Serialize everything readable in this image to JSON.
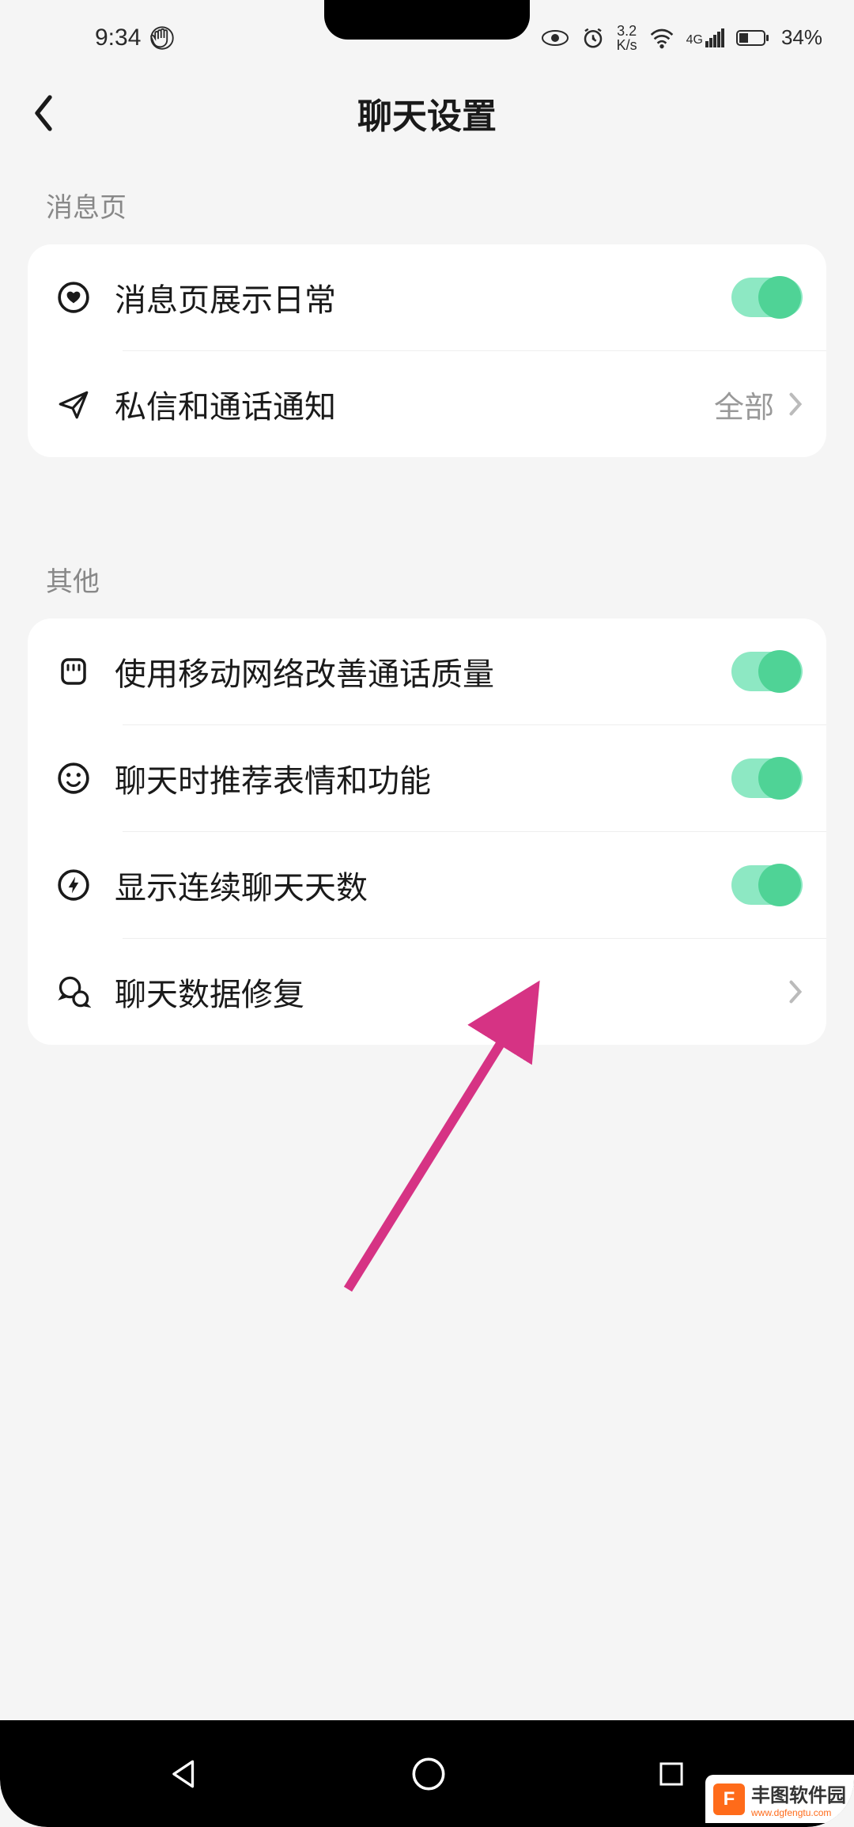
{
  "status": {
    "time": "9:34",
    "speed_top": "3.2",
    "speed_bottom": "K/s",
    "network_label": "4G",
    "battery_percent": "34%"
  },
  "header": {
    "title": "聊天设置"
  },
  "sections": {
    "messages": {
      "label": "消息页",
      "items": {
        "show_daily": "消息页展示日常",
        "dm_notifications": {
          "label": "私信和通话通知",
          "value": "全部"
        }
      }
    },
    "other": {
      "label": "其他",
      "items": {
        "mobile_data_call": "使用移动网络改善通话质量",
        "recommend_emoji": "聊天时推荐表情和功能",
        "show_chat_days": "显示连续聊天天数",
        "repair_chat_data": "聊天数据修复"
      }
    }
  },
  "watermark": {
    "name": "丰图软件园",
    "url": "www.dgfengtu.com"
  }
}
